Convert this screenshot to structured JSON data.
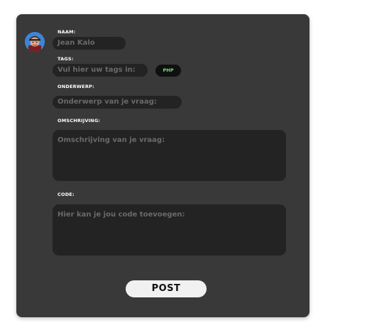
{
  "form": {
    "name_label": "NAAM:",
    "name_value": "Jean Kalo",
    "tags_label": "TAGS:",
    "tags_placeholder": "Vul hier uw tags in:",
    "tag_badge": "PHP",
    "subject_label": "ONDERWERP:",
    "subject_placeholder": "Onderwerp van je vraag:",
    "description_label": "OMSCHRIJVING:",
    "description_placeholder": "Omschrijving van je vraag:",
    "code_label": "CODE:",
    "code_placeholder": "Hier kan je jou code toevoegen:",
    "post_button": "POST"
  },
  "icons": {
    "avatar": "user-avatar-icon"
  },
  "colors": {
    "card_background": "#393939",
    "field_background": "#232323",
    "tag_text": "#7ee07e",
    "button_background": "#f1f1f1"
  }
}
